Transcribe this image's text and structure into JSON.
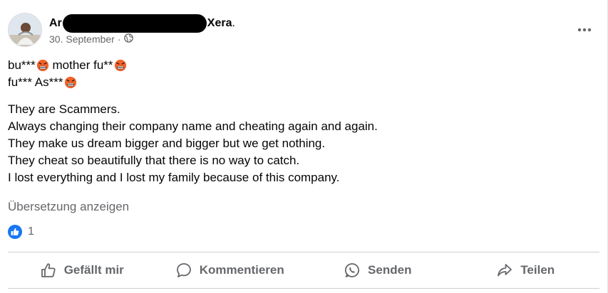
{
  "author": {
    "name_prefix": "Ar",
    "name_suffix": "Xera",
    "name_trailing": "."
  },
  "post_meta": {
    "date": "30. September",
    "separator": "·",
    "audience_icon": "globe-icon"
  },
  "post": {
    "line1_a": "bu***",
    "line1_b": " mother fu**",
    "line2_a": "fu*** As***",
    "emoji_icon": "enraged-face-emoji",
    "paragraph": [
      "They are Scammers.",
      "Always changing their company name and cheating again and again.",
      "They make us dream bigger and bigger but we get nothing.",
      "They cheat so beautifully that there is no way to catch.",
      "I lost everything and I lost my family because of this company."
    ]
  },
  "translate_label": "Übersetzung anzeigen",
  "reactions": {
    "icon": "like-reaction-icon",
    "count": "1"
  },
  "actions": {
    "like": "Gefällt mir",
    "comment": "Kommentieren",
    "send": "Senden",
    "share": "Teilen"
  },
  "colors": {
    "text": "#050505",
    "secondary_text": "#65676b",
    "like_blue": "#1877f2",
    "divider": "#ced0d4"
  }
}
